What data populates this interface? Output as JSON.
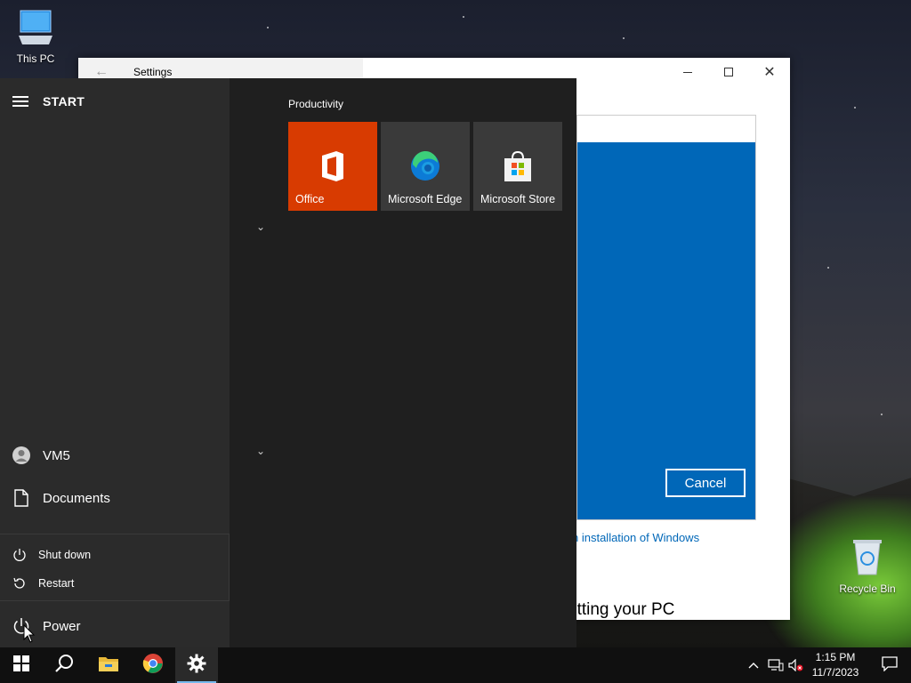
{
  "desktop": {
    "icons": [
      {
        "label": "This PC",
        "icon": "computer-icon"
      },
      {
        "label": "Recycle Bin",
        "icon": "recycle-bin-icon"
      }
    ]
  },
  "settings_window": {
    "title": "Settings",
    "cancel_label": "Cancel",
    "link_text": "n installation of Windows",
    "partial_heading": "etting your PC"
  },
  "start_menu": {
    "header_label": "START",
    "user_label": "VM5",
    "documents_label": "Documents",
    "power_label": "Power",
    "power_options": [
      {
        "label": "Shut down",
        "icon": "power-icon"
      },
      {
        "label": "Restart",
        "icon": "restart-icon"
      }
    ],
    "group_label": "Productivity",
    "tiles": [
      {
        "label": "Office",
        "icon": "office-icon",
        "color": "#d83b01"
      },
      {
        "label": "Microsoft Edge",
        "icon": "edge-icon",
        "color": "#3a3a3a"
      },
      {
        "label": "Microsoft Store",
        "icon": "store-icon",
        "color": "#3a3a3a"
      }
    ]
  },
  "taskbar": {
    "items": [
      "start-button",
      "search-button",
      "file-explorer-button",
      "chrome-button",
      "settings-button"
    ],
    "clock_time": "1:15 PM",
    "clock_date": "11/7/2023"
  },
  "colors": {
    "accent": "#0067b8",
    "office_tile": "#d83b01"
  }
}
